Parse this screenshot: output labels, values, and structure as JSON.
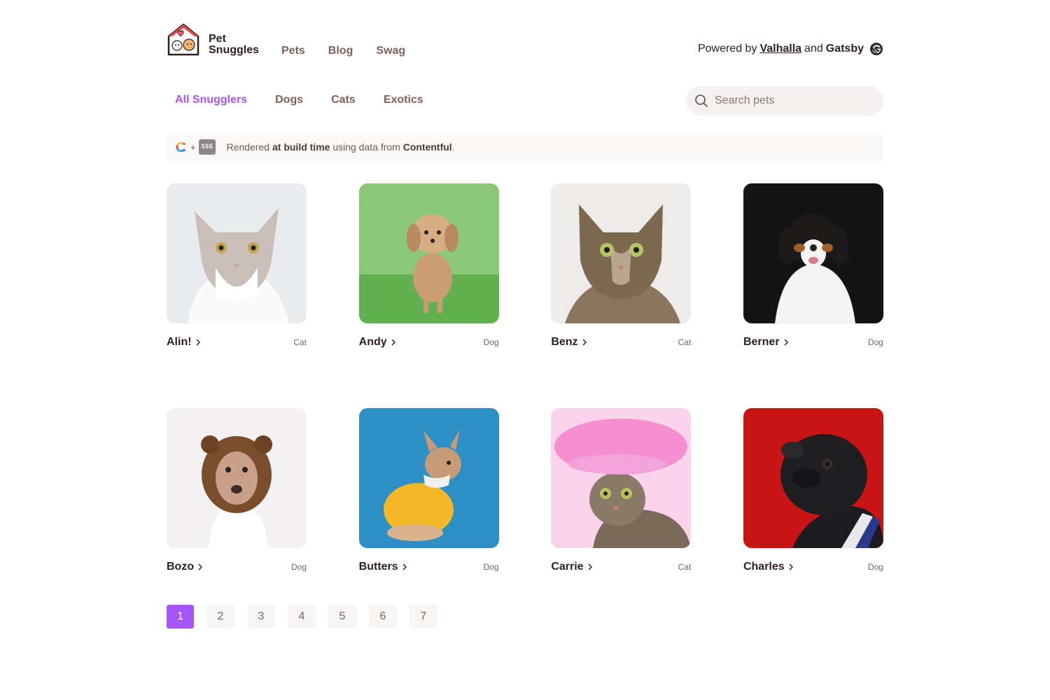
{
  "header": {
    "brand_line1": "Pet",
    "brand_line2": "Snuggles",
    "nav": [
      "Pets",
      "Blog",
      "Swag"
    ],
    "powered_prefix": "Powered by",
    "powered_link": "Valhalla",
    "powered_and": "and",
    "powered_suffix": "Gatsby"
  },
  "filters": {
    "items": [
      "All Snugglers",
      "Dogs",
      "Cats",
      "Exotics"
    ],
    "active": "All Snugglers"
  },
  "search": {
    "placeholder": "Search pets"
  },
  "banner": {
    "plus": "+",
    "ssg_badge": "SSG",
    "text_1": "Rendered",
    "text_bold_1": "at build time",
    "text_2": "using data from",
    "text_bold_2": "Contentful",
    "text_end": "."
  },
  "pets": [
    {
      "name": "Alin!",
      "type": "Cat"
    },
    {
      "name": "Andy",
      "type": "Dog"
    },
    {
      "name": "Benz",
      "type": "Cat"
    },
    {
      "name": "Berner",
      "type": "Dog"
    },
    {
      "name": "Bozo",
      "type": "Dog"
    },
    {
      "name": "Butters",
      "type": "Dog"
    },
    {
      "name": "Carrie",
      "type": "Cat"
    },
    {
      "name": "Charles",
      "type": "Dog"
    }
  ],
  "pagination": {
    "pages": [
      "1",
      "2",
      "3",
      "4",
      "5",
      "6",
      "7"
    ],
    "current": "1"
  },
  "colors": {
    "accent": "#a855f7",
    "nav_text": "#7d615c",
    "heading": "#2f2220"
  }
}
